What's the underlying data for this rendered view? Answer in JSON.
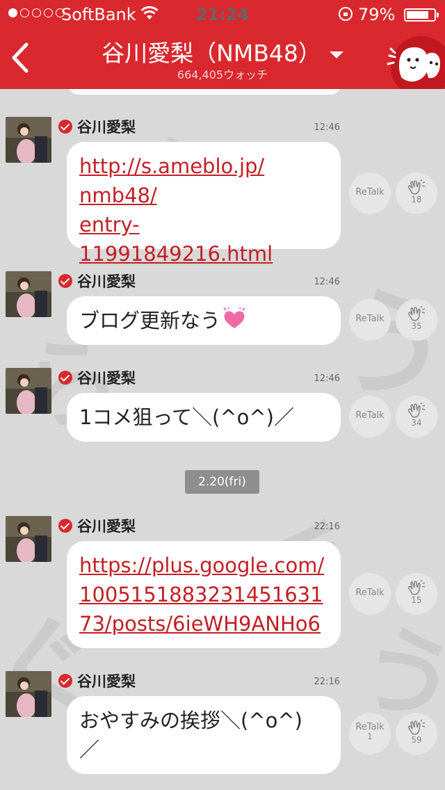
{
  "status": {
    "carrier": "SoftBank",
    "time": "21:24",
    "battery": "79%",
    "battery_level": 0.79,
    "signal_bars": 1
  },
  "header": {
    "title": "谷川愛梨（NMB48）",
    "watchers": "664,405ウォッチ"
  },
  "colors": {
    "brand_red": "#d9282e",
    "link_red": "#c21f25",
    "background": "#d9d9d9"
  },
  "retalk_label": "ReTalk",
  "messages": [
    {
      "author": "谷川愛梨",
      "time": "12:46",
      "lines": [
        "http://s.ameblo.jp/",
        "nmb48/",
        "entry-11991849216.html"
      ],
      "is_link": true,
      "retalk_count": "",
      "clap_count": "18"
    },
    {
      "author": "谷川愛梨",
      "time": "12:46",
      "text": "ブログ更新なう",
      "emoji": "heart-emoji",
      "retalk_count": "",
      "clap_count": "35"
    },
    {
      "author": "谷川愛梨",
      "time": "12:46",
      "text": "1コメ狙って＼(^o^)／",
      "retalk_count": "",
      "clap_count": "34"
    },
    {
      "author": "谷川愛梨",
      "time": "22:16",
      "lines": [
        "https://plus.google.com/",
        "100515188323145163​1",
        "73/posts/6ieWH9ANHo6"
      ],
      "is_link": true,
      "retalk_count": "",
      "clap_count": "15"
    },
    {
      "author": "谷川愛梨",
      "time": "22:16",
      "lines": [
        "おやすみの挨拶＼(^o^)",
        "／"
      ],
      "retalk_count": "1",
      "clap_count": "59"
    }
  ],
  "date_separator": "2.20(fri)"
}
